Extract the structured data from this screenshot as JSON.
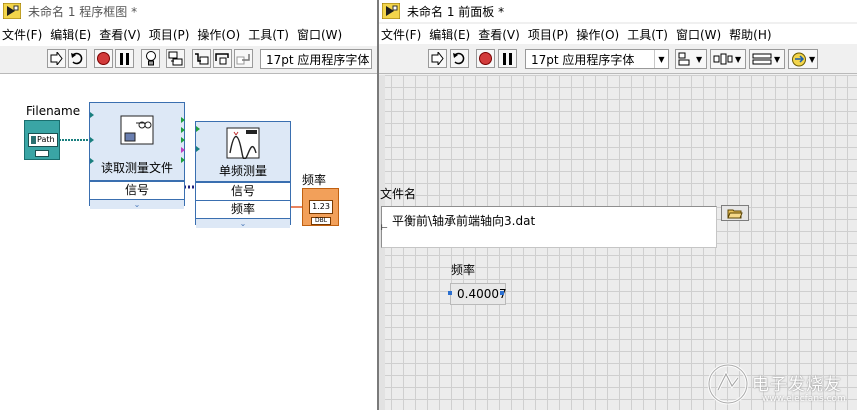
{
  "block_diagram": {
    "title": "未命名 1 程序框图 *",
    "menu": [
      "文件(F)",
      "编辑(E)",
      "查看(V)",
      "项目(P)",
      "操作(O)",
      "工具(T)",
      "窗口(W)"
    ],
    "toolbar": {
      "font_label": "17pt 应用程序字体"
    },
    "filename_label": "Filename",
    "path_terminal_text": "Path",
    "read_vi": {
      "title": "读取测量文件",
      "row_label": "信号"
    },
    "tone_vi": {
      "title": "单频测量",
      "row_input": "信号",
      "row_output": "频率"
    },
    "freq_label": "频率",
    "freq_terminal_text": "1.23",
    "freq_terminal_type": "DBL"
  },
  "front_panel": {
    "title": "未命名 1 前面板 *",
    "menu": [
      "文件(F)",
      "编辑(E)",
      "查看(V)",
      "项目(P)",
      "操作(O)",
      "工具(T)",
      "窗口(W)",
      "帮助(H)"
    ],
    "toolbar": {
      "font_label": "17pt 应用程序字体"
    },
    "path_label": "文件名",
    "path_value": "平衡前\\轴承前端轴向3.dat",
    "freq_label": "频率",
    "freq_value": "0.40007"
  },
  "watermark": {
    "text": "电子发烧友",
    "subtext": "www.elecfans.com"
  },
  "colors": {
    "wire_path": "#1a7f7f",
    "wire_signal": "#20207a",
    "wire_dbl": "#e0501a",
    "exvi_border": "#3a6fb0"
  }
}
